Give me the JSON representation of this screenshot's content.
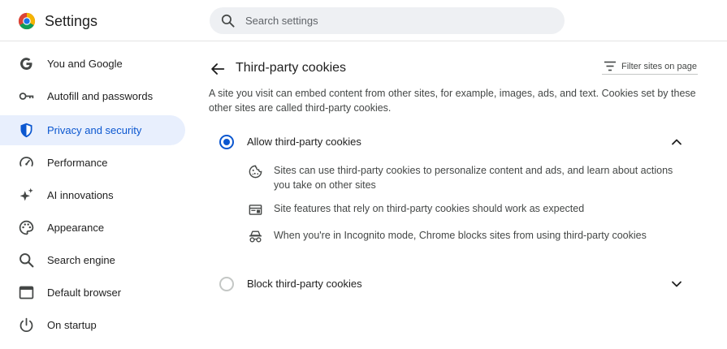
{
  "app": {
    "title": "Settings"
  },
  "search": {
    "placeholder": "Search settings"
  },
  "sidebar": {
    "items": [
      {
        "label": "You and Google"
      },
      {
        "label": "Autofill and passwords"
      },
      {
        "label": "Privacy and security",
        "active": true
      },
      {
        "label": "Performance"
      },
      {
        "label": "AI innovations"
      },
      {
        "label": "Appearance"
      },
      {
        "label": "Search engine"
      },
      {
        "label": "Default browser"
      },
      {
        "label": "On startup"
      }
    ]
  },
  "page": {
    "title": "Third-party cookies",
    "filter_label": "Filter sites on page",
    "description": "A site you visit can embed content from other sites, for example, images, ads, and text. Cookies set by these other sites are called third-party cookies."
  },
  "options": [
    {
      "label": "Allow third-party cookies",
      "selected": true,
      "expanded": true,
      "details": [
        {
          "icon": "cookie-icon",
          "text": "Sites can use third-party cookies to personalize content and ads, and learn about actions you take on other sites"
        },
        {
          "icon": "web-layout-icon",
          "text": "Site features that rely on third-party cookies should work as expected"
        },
        {
          "icon": "incognito-icon",
          "text": "When you're in Incognito mode, Chrome blocks sites from using third-party cookies"
        }
      ]
    },
    {
      "label": "Block third-party cookies",
      "selected": false,
      "expanded": false
    }
  ],
  "colors": {
    "accent": "#0b57d0",
    "active_background": "#e8effd",
    "search_background": "#eef0f3",
    "icon_gray": "#444746"
  }
}
